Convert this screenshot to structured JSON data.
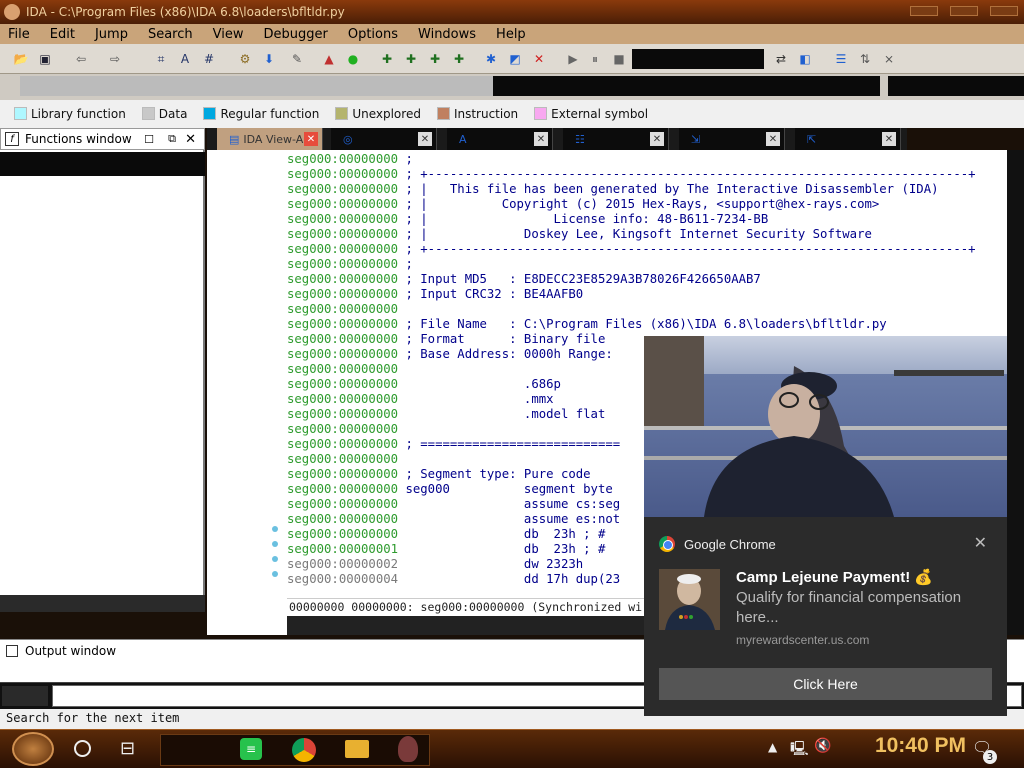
{
  "window": {
    "title": "IDA - C:\\Program Files (x86)\\IDA 6.8\\loaders\\bfltldr.py"
  },
  "menu": [
    "File",
    "Edit",
    "Jump",
    "Search",
    "View",
    "Debugger",
    "Options",
    "Windows",
    "Help"
  ],
  "legend": [
    {
      "label": "Library function",
      "color": "#aef7ff"
    },
    {
      "label": "Data",
      "color": "#c8c8c8"
    },
    {
      "label": "Regular function",
      "color": "#00a8e0"
    },
    {
      "label": "Unexplored",
      "color": "#b4b46e"
    },
    {
      "label": "Instruction",
      "color": "#c08060"
    },
    {
      "label": "External symbol",
      "color": "#f8a8f0"
    }
  ],
  "functions_window": {
    "title": "Functions window"
  },
  "tabs": [
    {
      "label": "IDA View-A",
      "active": true
    },
    {
      "label": ""
    },
    {
      "label": ""
    },
    {
      "label": ""
    },
    {
      "label": ""
    },
    {
      "label": ""
    }
  ],
  "disasm_lines": [
    {
      "addr": "seg000:00000000",
      "text": ";"
    },
    {
      "addr": "seg000:00000000",
      "text": "; +-------------------------------------------------------------------------+"
    },
    {
      "addr": "seg000:00000000",
      "text": "; |   This file has been generated by The Interactive Disassembler (IDA)"
    },
    {
      "addr": "seg000:00000000",
      "text": "; |          Copyright (c) 2015 Hex-Rays, <support@hex-rays.com>"
    },
    {
      "addr": "seg000:00000000",
      "text": "; |                 License info: 48-B611-7234-BB"
    },
    {
      "addr": "seg000:00000000",
      "text": "; |             Doskey Lee, Kingsoft Internet Security Software"
    },
    {
      "addr": "seg000:00000000",
      "text": "; +-------------------------------------------------------------------------+"
    },
    {
      "addr": "seg000:00000000",
      "text": ";"
    },
    {
      "addr": "seg000:00000000",
      "text": "; Input MD5   : E8DECC23E8529A3B78026F426650AAB7"
    },
    {
      "addr": "seg000:00000000",
      "text": "; Input CRC32 : BE4AAFB0"
    },
    {
      "addr": "seg000:00000000",
      "text": ""
    },
    {
      "addr": "seg000:00000000",
      "text": "; File Name   : C:\\Program Files (x86)\\IDA 6.8\\loaders\\bfltldr.py"
    },
    {
      "addr": "seg000:00000000",
      "text": "; Format      : Binary file"
    },
    {
      "addr": "seg000:00000000",
      "text": "; Base Address: 0000h Range:"
    },
    {
      "addr": "seg000:00000000",
      "text": ""
    },
    {
      "addr": "seg000:00000000",
      "text": "                .686p"
    },
    {
      "addr": "seg000:00000000",
      "text": "                .mmx"
    },
    {
      "addr": "seg000:00000000",
      "text": "                .model flat"
    },
    {
      "addr": "seg000:00000000",
      "text": ""
    },
    {
      "addr": "seg000:00000000",
      "text": "; ==========================="
    },
    {
      "addr": "seg000:00000000",
      "text": ""
    },
    {
      "addr": "seg000:00000000",
      "text": "; Segment type: Pure code"
    },
    {
      "addr": "seg000:00000000",
      "text": "seg000          segment byte"
    },
    {
      "addr": "seg000:00000000",
      "text": "                assume cs:seg"
    },
    {
      "addr": "seg000:00000000",
      "text": "                assume es:not"
    },
    {
      "addr": "seg000:00000000",
      "text": "                db  23h ; #"
    },
    {
      "addr": "seg000:00000001",
      "text": "                db  23h ; #"
    },
    {
      "addr": "seg000:00000002",
      "text": "                dw 2323h",
      "gray": true
    },
    {
      "addr": "seg000:00000004",
      "text": "                dd 17h dup(23",
      "gray": true
    }
  ],
  "disasm_status": "00000000 00000000: seg000:00000000 (Synchronized wi",
  "output_window": {
    "title": "Output window"
  },
  "status_line": "Search for the next item",
  "taskbar": {
    "clock": "10:40 PM",
    "notification_count": "3"
  },
  "notification": {
    "app": "Google Chrome",
    "close": "✕",
    "title": "Camp Lejeune Payment! 💰",
    "body": "Qualify for financial compensation here...",
    "source": "myrewardscenter.us.com",
    "button": "Click Here"
  }
}
